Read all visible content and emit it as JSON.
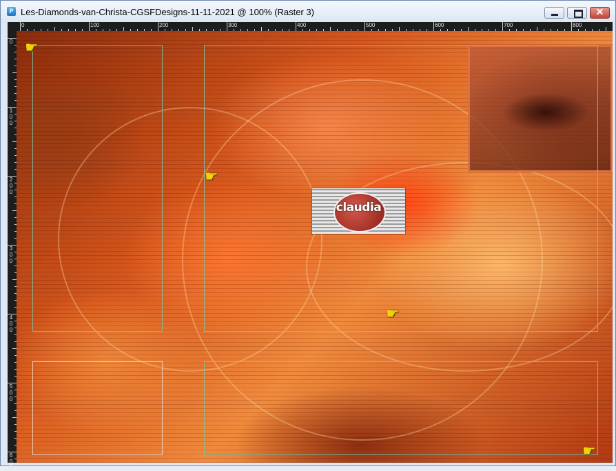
{
  "window": {
    "title": "Les-Diamonds-van-Christa-CGSFDesigns-11-11-2021 @ 100% (Raster 3)",
    "app_icon": "psp-icon",
    "controls": [
      "minimize-icon",
      "maximize-icon",
      "close-icon"
    ]
  },
  "ruler": {
    "top_labels": [
      "0",
      "100",
      "200",
      "300",
      "400",
      "500",
      "600",
      "700",
      "800"
    ],
    "left_labels": [
      "0",
      "100",
      "200",
      "300",
      "400",
      "500",
      "600"
    ]
  },
  "canvas": {
    "logo_text": "claudia",
    "pointer_icons": [
      "pointing-hand-icon",
      "pointing-hand-icon",
      "pointing-hand-icon",
      "pointing-hand-icon"
    ],
    "colors": {
      "accent_red": "#ff4614",
      "orange": "#f08a3c",
      "dark": "#8a2c0c"
    }
  }
}
